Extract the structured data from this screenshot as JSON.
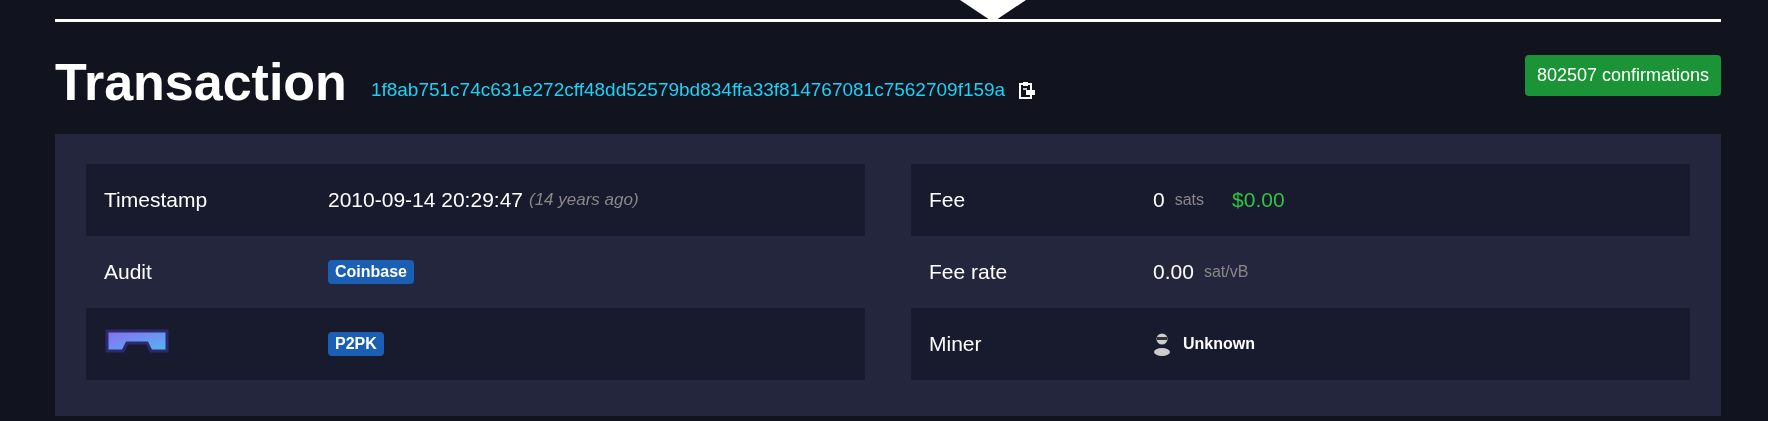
{
  "title": "Transaction",
  "txid": "1f8ab751c74c631e272cff48dd52579bd834ffa33f814767081c7562709f159a",
  "confirmations": "802507 confirmations",
  "left_rows": [
    {
      "kind": "timestamp",
      "label": "Timestamp",
      "value": "2010-09-14 20:29:47",
      "note": "(14 years ago)"
    },
    {
      "kind": "badge",
      "label": "Audit",
      "badge": "Coinbase"
    },
    {
      "kind": "badge_icon",
      "badge": "P2PK"
    }
  ],
  "right_rows": [
    {
      "kind": "amount",
      "label": "Fee",
      "value": "0",
      "unit": "sats",
      "fiat": "$0.00"
    },
    {
      "kind": "amount",
      "label": "Fee rate",
      "value": "0.00",
      "unit": "sat/vB"
    },
    {
      "kind": "miner",
      "label": "Miner",
      "value": "Unknown"
    }
  ]
}
